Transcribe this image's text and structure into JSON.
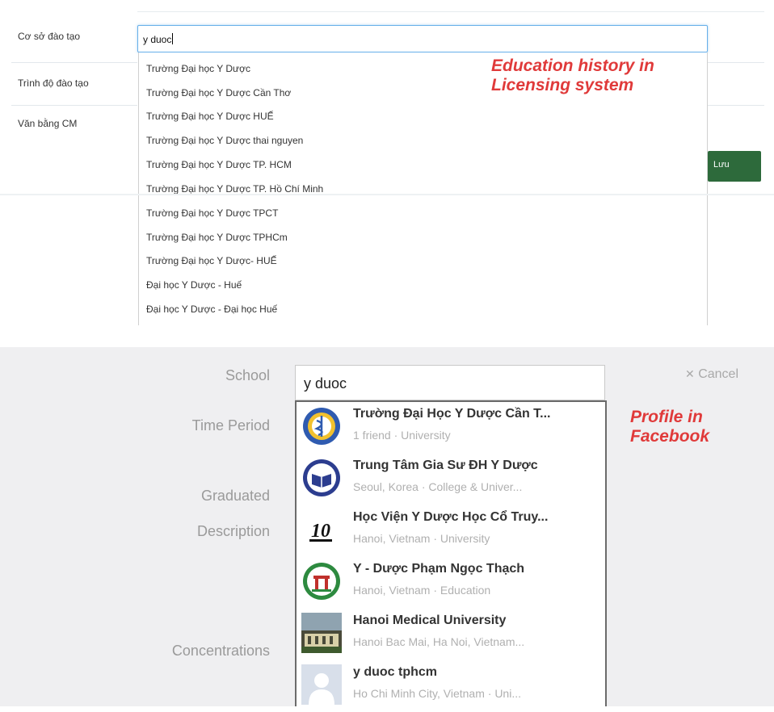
{
  "licensing": {
    "form": {
      "field_institution_label": "Cơ sở đào tạo",
      "field_level_label": "Trình độ đào tạo",
      "field_degree_label": "Văn bằng CM",
      "input_value": "y duoc",
      "save_label": "Lưu"
    },
    "suggestions": [
      "Trường Đại học Y Dược",
      "Trường Đại học Y Dược Cần Thơ",
      "Trường Đại học Y Dược HUẾ",
      "Trường Đại học Y Dược thai nguyen",
      "Trường Đại học Y Dược TP. HCM",
      "Trường Đại học Y Dược TP. Hồ Chí Minh",
      "Trường Đại học Y Dược TPCT",
      "Trường Đại học Y Dược TPHCm",
      "Trường Đại học Y Dược- HUẾ",
      "Đại học Y Dược - Huế",
      "Đại học Y Dược - Đại học Huế"
    ],
    "annotation": [
      "Education history in",
      "Licensing system"
    ]
  },
  "facebook": {
    "labels": {
      "school": "School",
      "time_period": "Time Period",
      "graduated": "Graduated",
      "description": "Description",
      "concentrations": "Concentrations"
    },
    "input_value": "y duoc",
    "cancel_label": "Cancel",
    "results": [
      {
        "title": "Trường Đại Học Y Dược Cần T...",
        "subtitle": "1 friend · University",
        "icon": "caduceus-seal-icon"
      },
      {
        "title": "Trung Tâm Gia Sư ĐH Y Dược",
        "subtitle": "Seoul, Korea · College & Univer...",
        "icon": "book-seal-icon"
      },
      {
        "title": "Học Viện Y Dược Học Cổ Truy...",
        "subtitle": "Hanoi, Vietnam · University",
        "icon": "ten-logo-icon"
      },
      {
        "title": "Y - Dược Phạm Ngọc Thạch",
        "subtitle": "Hanoi, Vietnam · Education",
        "icon": "gate-seal-icon"
      },
      {
        "title": "Hanoi Medical University",
        "subtitle": "Hanoi Bac Mai, Ha Noi, Vietnam...",
        "icon": "building-photo-icon"
      },
      {
        "title": "y duoc tphcm",
        "subtitle": "Ho Chi Minh City, Vietnam · Uni...",
        "icon": "default-profile-icon"
      }
    ],
    "annotation": [
      "Profile in",
      "Facebook"
    ]
  },
  "colors": {
    "annotation": "#e03a3a",
    "save_button": "#2d6a3b",
    "focus_border": "#66afe9",
    "fb_panel_bg": "#efeff1"
  }
}
